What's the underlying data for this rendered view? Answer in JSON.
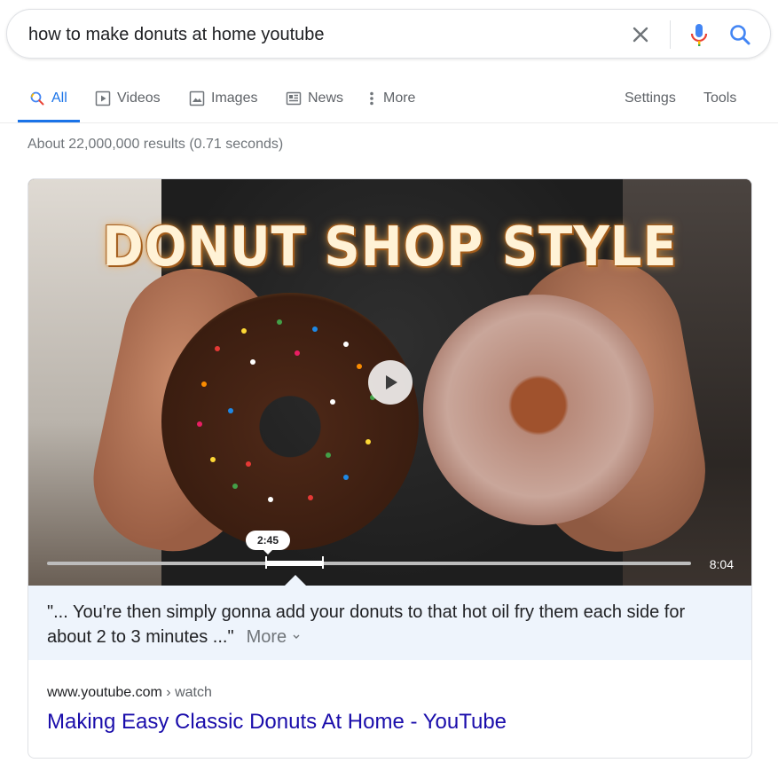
{
  "search": {
    "query": "how to make donuts at home youtube",
    "clear_icon": "close-icon",
    "mic_icon": "microphone-icon",
    "search_icon": "search-icon"
  },
  "tabs": [
    {
      "label": "All",
      "icon": "search-icon",
      "active": true
    },
    {
      "label": "Videos",
      "icon": "play-square-icon"
    },
    {
      "label": "Images",
      "icon": "image-icon"
    },
    {
      "label": "News",
      "icon": "newspaper-icon"
    },
    {
      "label": "More",
      "icon": "vertical-dots-icon"
    }
  ],
  "tools": {
    "settings": "Settings",
    "tools": "Tools"
  },
  "stats": "About 22,000,000 results (0.71 seconds)",
  "video": {
    "overlay_text": "DONUT SHOP STYLE",
    "timestamp": "2:45",
    "duration": "8:04",
    "highlight_start_seconds": 165,
    "highlight_end_seconds": 205,
    "total_seconds": 484
  },
  "snippet": {
    "text": "\"... You're then simply gonna add your donuts to that hot oil fry them each side for about 2 to 3 minutes ...\"",
    "more_label": "More"
  },
  "result": {
    "domain": "www.youtube.com",
    "path": " › watch",
    "title": "Making Easy Classic Donuts At Home - YouTube"
  },
  "colors": {
    "accent": "#1a73e8",
    "link": "#1a0dab",
    "snippet_bg": "#eef4fc"
  }
}
